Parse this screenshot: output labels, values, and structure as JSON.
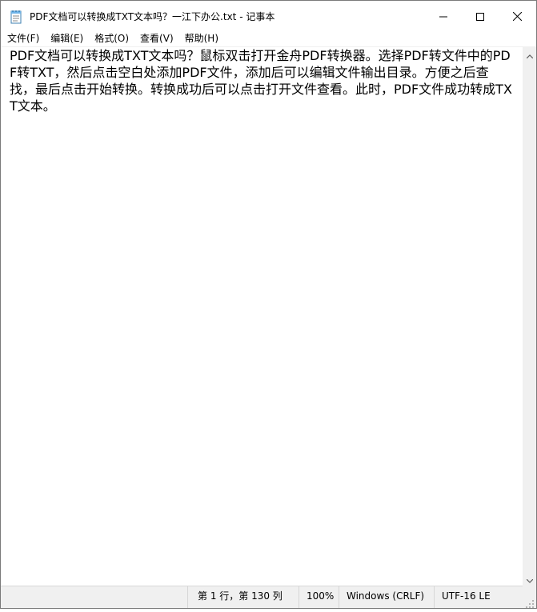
{
  "window": {
    "title": "PDF文档可以转换成TXT文本吗？一江下办公.txt - 记事本"
  },
  "menu": {
    "items": [
      {
        "label": "文件(F)"
      },
      {
        "label": "编辑(E)"
      },
      {
        "label": "格式(O)"
      },
      {
        "label": "查看(V)"
      },
      {
        "label": "帮助(H)"
      }
    ]
  },
  "editor": {
    "content": "PDF文档可以转换成TXT文本吗？鼠标双击打开金舟PDF转换器。选择PDF转文件中的PDF转TXT，然后点击空白处添加PDF文件，添加后可以编辑文件输出目录。方便之后查找，最后点击开始转换。转换成功后可以点击打开文件查看。此时，PDF文件成功转成TXT文本。"
  },
  "status": {
    "position": "第 1 行，第 130 列",
    "zoom": "100%",
    "line_ending": "Windows (CRLF)",
    "encoding": "UTF-16 LE"
  },
  "icons": {
    "app": "notepad-icon",
    "minimize": "minimize-icon",
    "maximize": "maximize-icon",
    "close": "close-icon",
    "scroll_up": "chevron-up-icon",
    "scroll_down": "chevron-down-icon",
    "grip": "resize-grip-icon"
  }
}
